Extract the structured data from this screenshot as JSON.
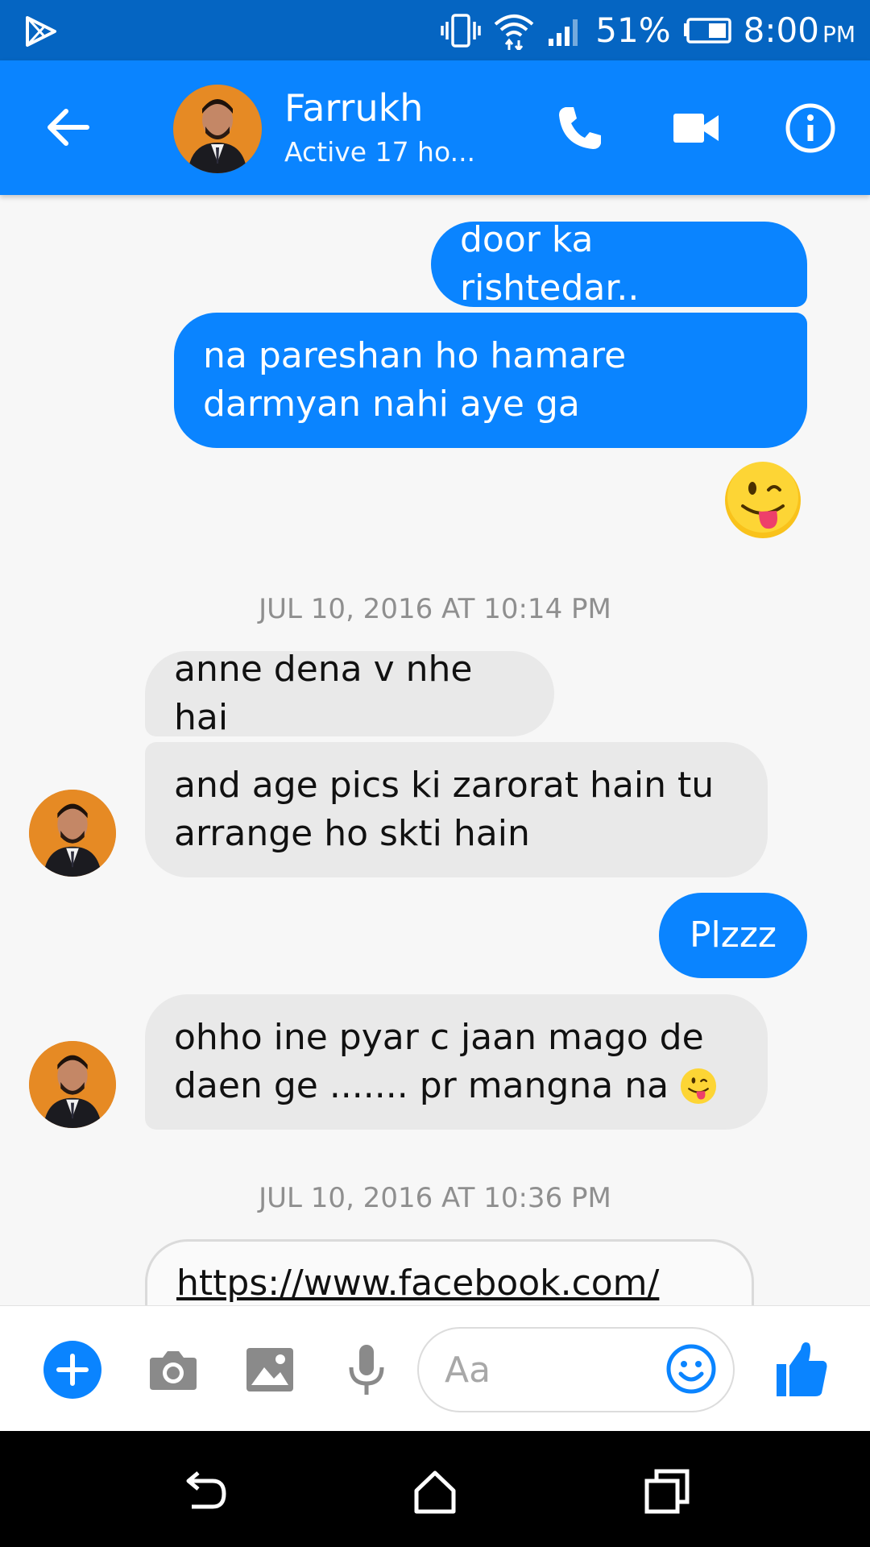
{
  "status_bar": {
    "battery": "51%",
    "time": "8:00",
    "ampm": "PM",
    "icons": [
      "play-store-icon",
      "vibrate-icon",
      "wifi-icon",
      "signal-icon",
      "battery-icon"
    ]
  },
  "header": {
    "contact_name": "Farrukh",
    "status": "Active 17 ho...",
    "icons": [
      "back-arrow-icon",
      "phone-icon",
      "video-camera-icon",
      "info-icon"
    ],
    "color": "#0a84ff"
  },
  "messages": {
    "m1": "door ka rishtedar..",
    "m2_line1": "na pareshan ho hamare",
    "m2_line2": "darmyan nahi aye ga",
    "ts1": "JUL 10, 2016 AT 10:14 PM",
    "m3": "anne dena v nhe hai",
    "m4_line1": "and age pics ki zarorat hain tu",
    "m4_line2": "arrange ho skti hain",
    "m5": "Plzzz",
    "m6_line1": "ohho ine pyar c jaan mago de",
    "m6_line2": "daen ge ....... pr mangna na",
    "ts2": "JUL 10, 2016 AT 10:36 PM",
    "m7": "https://www.facebook.com/"
  },
  "composer": {
    "placeholder": "Aa",
    "icons": [
      "plus-icon",
      "camera-icon",
      "image-icon",
      "microphone-icon",
      "emoji-icon",
      "thumbs-up-icon"
    ]
  },
  "colors": {
    "accent": "#0a84ff",
    "status_bar": "#0565c2",
    "incoming_bubble": "#e9e9e9"
  }
}
